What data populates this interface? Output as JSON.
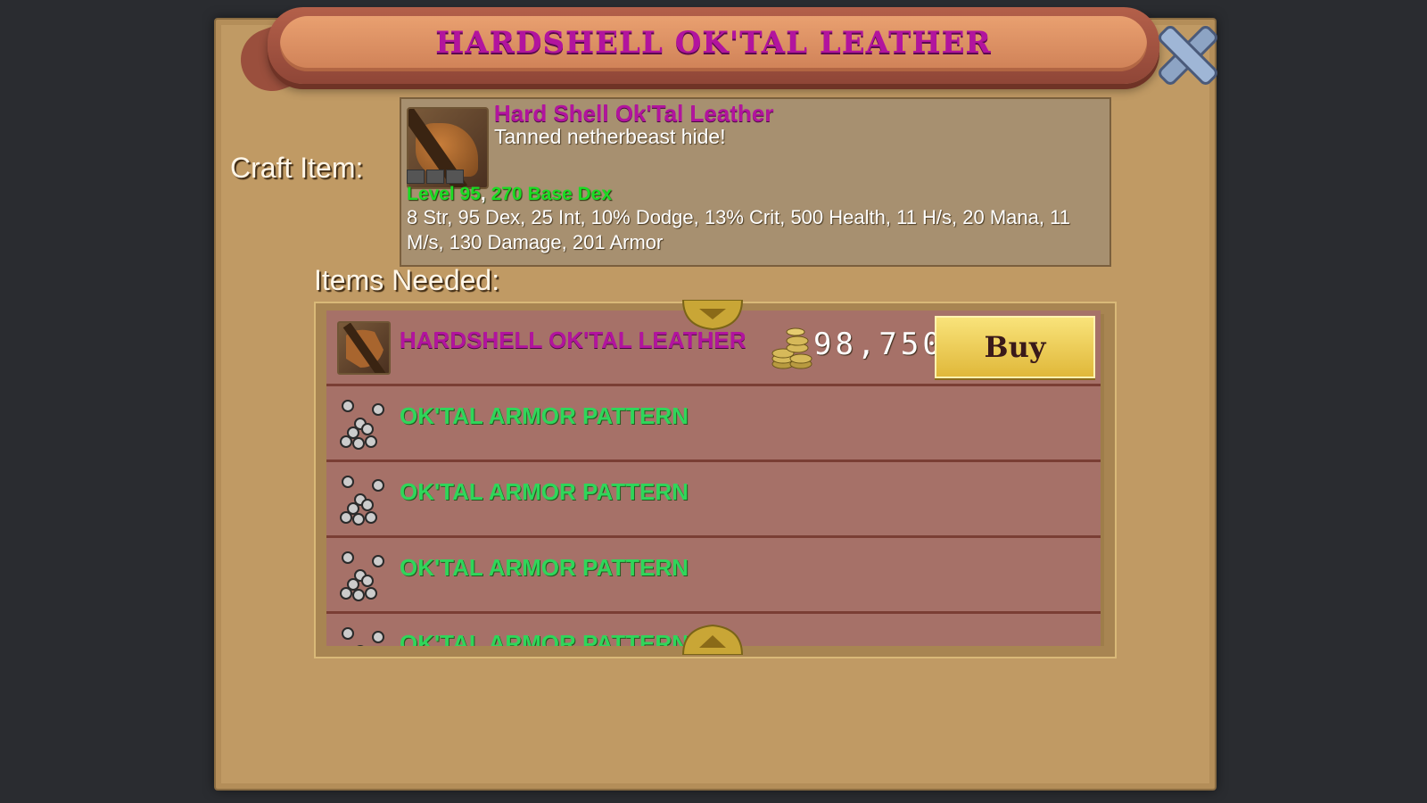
{
  "window": {
    "title": "HARDSHELL OK'TAL LEATHER"
  },
  "craft": {
    "label": "Craft Item:",
    "item_name": "Hard Shell Ok'Tal Leather",
    "item_description": "Tanned netherbeast hide!",
    "level_text": "Level 95",
    "base_stat_text": "270 Base Dex",
    "stats_text": "8 Str, 95 Dex, 25 Int, 10% Dodge, 13% Crit, 500 Health, 11 H/s, 20 Mana, 11 M/s, 130 Damage, 201 Armor"
  },
  "needed": {
    "label": "Items Needed:",
    "items": [
      {
        "name": "HARDSHELL OK'TAL LEATHER",
        "icon": "leather-icon",
        "color": "#b2149e",
        "price": "98,750",
        "buy_label": "Buy"
      },
      {
        "name": "OK'TAL ARMOR PATTERN",
        "icon": "rings-icon",
        "color": "#2fd65a"
      },
      {
        "name": "OK'TAL ARMOR PATTERN",
        "icon": "rings-icon",
        "color": "#2fd65a"
      },
      {
        "name": "OK'TAL ARMOR PATTERN",
        "icon": "rings-icon",
        "color": "#2fd65a"
      },
      {
        "name": "OK'TAL ARMOR PATTERN",
        "icon": "rings-icon",
        "color": "#2fd65a"
      }
    ]
  },
  "colors": {
    "background": "#2a2c30",
    "panel": "#c09a64",
    "title_purple": "#b2149e",
    "level_green": "#1bdc24",
    "buy_gold": "#f0cc55"
  }
}
